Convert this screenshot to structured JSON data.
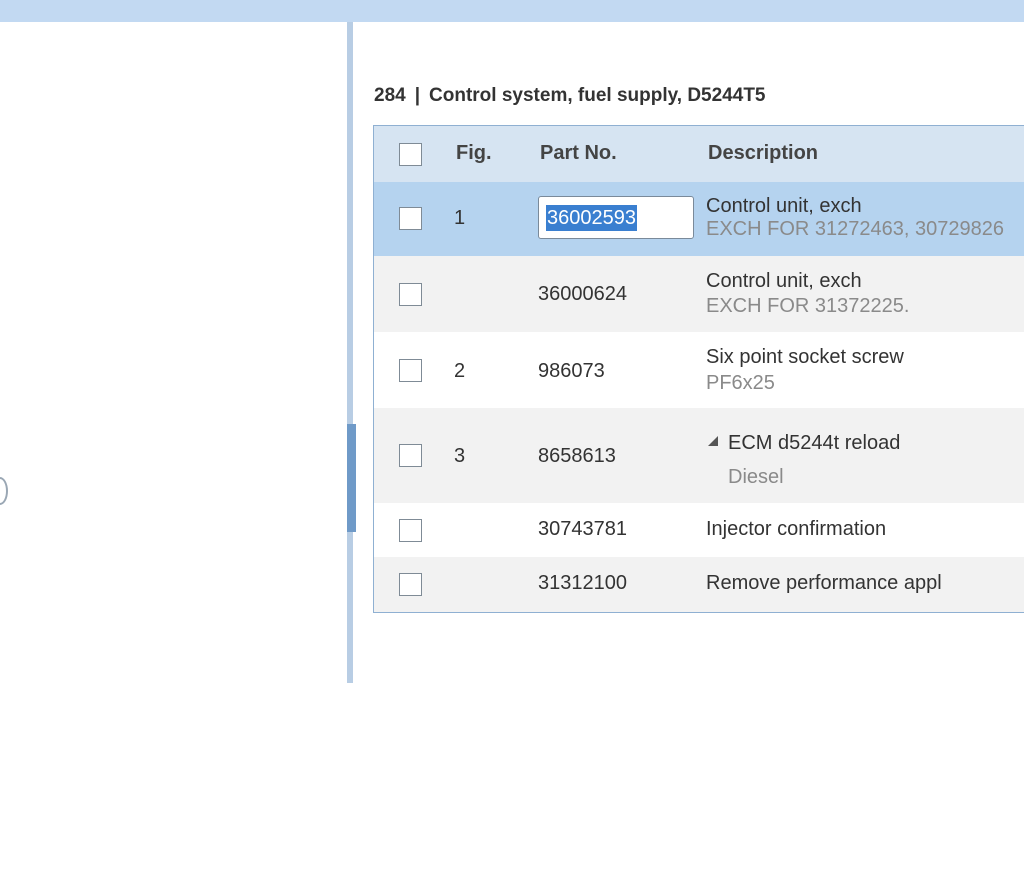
{
  "section": {
    "number": "284",
    "separator": "|",
    "title": "Control system, fuel supply, D5244T5"
  },
  "table": {
    "headers": {
      "fig": "Fig.",
      "part_no": "Part No.",
      "description": "Description"
    },
    "rows": [
      {
        "fig": "1",
        "part_no": "36002593",
        "description": "Control unit, exch",
        "note": "EXCH FOR 31272463, 30729826",
        "selected": true
      },
      {
        "fig": "",
        "part_no": "36000624",
        "description": "Control unit, exch",
        "note": "EXCH FOR 31372225."
      },
      {
        "fig": "2",
        "part_no": "986073",
        "description": "Six point socket screw",
        "note": "PF6x25"
      },
      {
        "fig": "3",
        "part_no": "8658613",
        "description": "ECM d5244t reload",
        "note": "Diesel",
        "expandable": true
      },
      {
        "fig": "",
        "part_no": "30743781",
        "description": "Injector confirmation",
        "note": ""
      },
      {
        "fig": "",
        "part_no": "31312100",
        "description": "Remove performance appl",
        "note": ""
      }
    ]
  },
  "colors": {
    "header_bg": "#d6e4f2",
    "selected_row_bg": "#b5d3ef",
    "alt_row_bg": "#f2f2f2",
    "splitter_handle": "#6f9ac8",
    "text_selection": "#3a7fd0"
  },
  "icons": {
    "expand": "triangle-expanded-icon",
    "splitter": "chevron-left-icon"
  }
}
